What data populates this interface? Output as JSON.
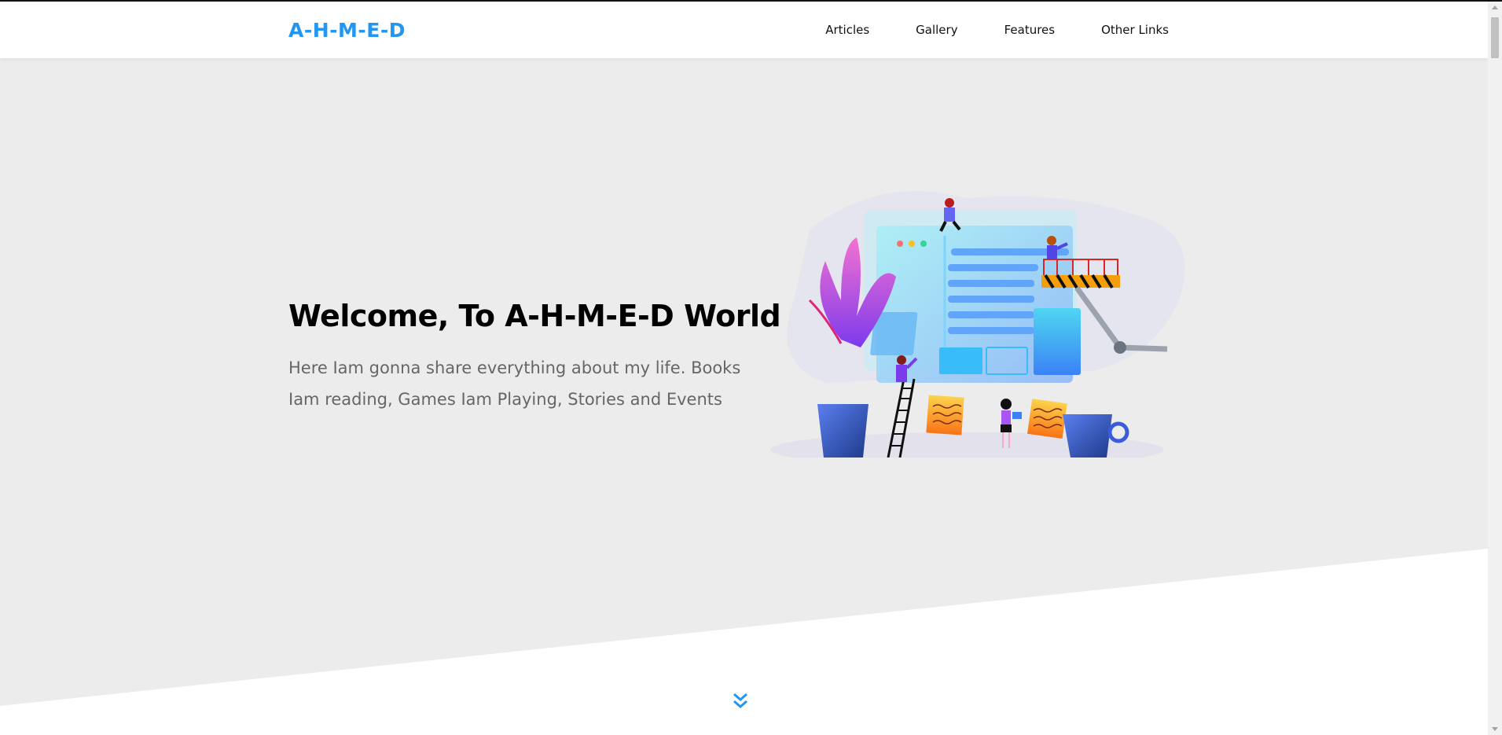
{
  "header": {
    "logo": "A-H-M-E-D",
    "nav": [
      {
        "label": "Articles"
      },
      {
        "label": "Gallery"
      },
      {
        "label": "Features"
      },
      {
        "label": "Other Links"
      }
    ]
  },
  "hero": {
    "title": "Welcome, To A-H-M-E-D World",
    "text": "Here Iam gonna share everything about my life. Books Iam reading, Games Iam Playing, Stories and Events",
    "illustration_icon": "web-development-illustration",
    "scroll_icon": "double-chevron-down-icon"
  },
  "colors": {
    "accent": "#2196f3",
    "hero_bg": "#ececec",
    "text_muted": "#666666"
  }
}
